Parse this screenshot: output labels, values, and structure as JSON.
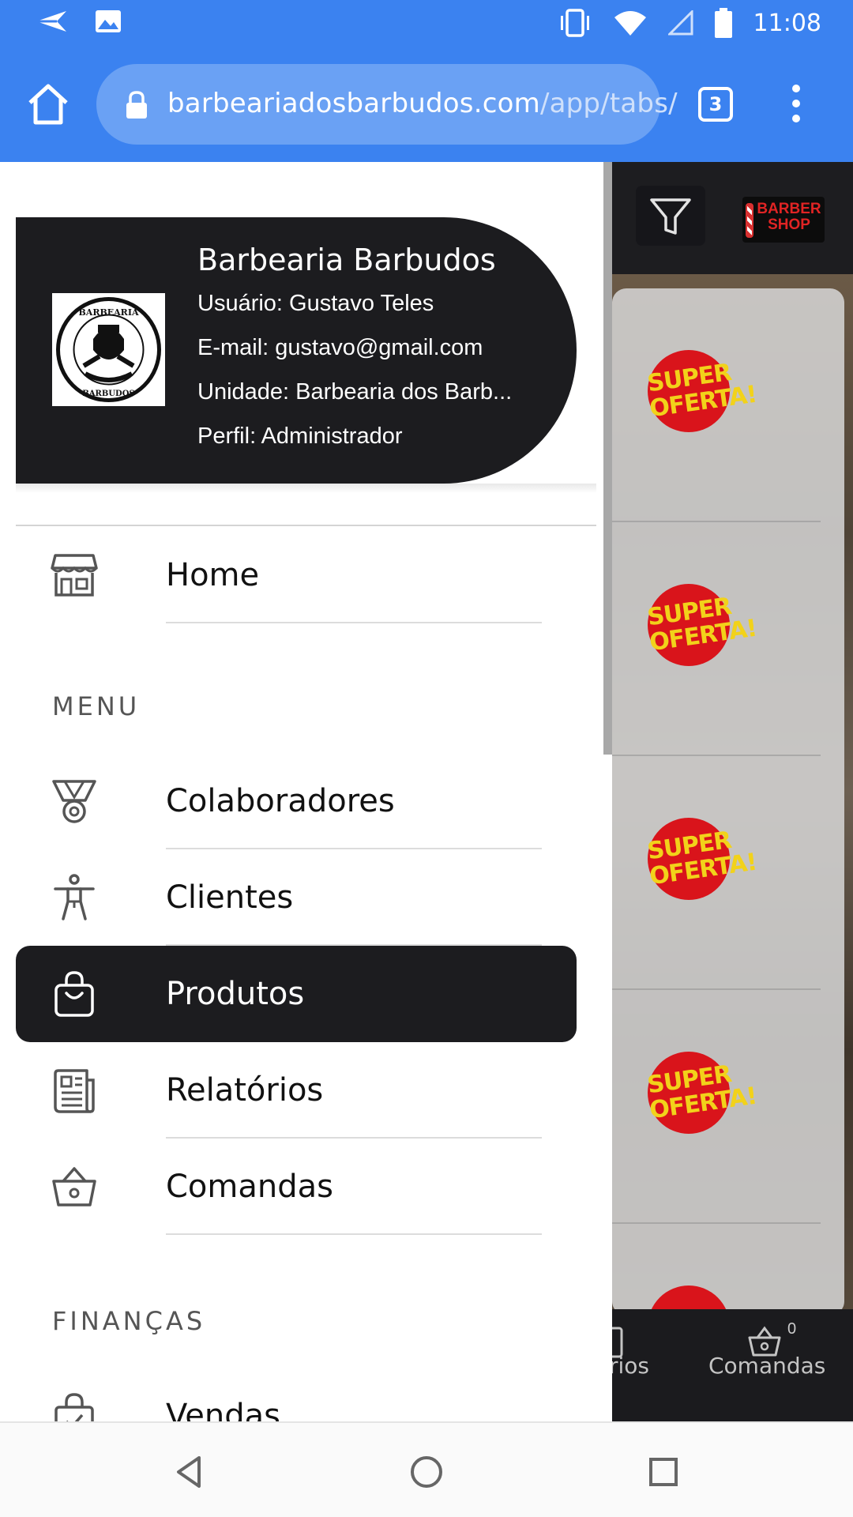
{
  "status_bar": {
    "time": "11:08",
    "icons": [
      "send-icon",
      "image-icon",
      "vibrate-icon",
      "wifi-icon",
      "signal-icon",
      "battery-icon"
    ]
  },
  "browser": {
    "url_domain": "barbeariadosbarbudos.com",
    "url_path": "/app/tabs/",
    "tab_count": "3"
  },
  "profile": {
    "name": "Barbearia Barbudos",
    "user": "Usuário: Gustavo Teles",
    "email": "E-mail: gustavo@gmail.com",
    "unit": "Unidade: Barbearia dos Barb...",
    "role": "Perfil: Administrador",
    "logo_text": "BARBEARIA DOS BARBUDOS"
  },
  "drawer": {
    "home_label": "Home",
    "menu_title": "MENU",
    "items": [
      {
        "label": "Colaboradores",
        "icon": "medal-icon"
      },
      {
        "label": "Clientes",
        "icon": "person-icon"
      },
      {
        "label": "Produtos",
        "icon": "shopping-bag-icon",
        "active": true
      },
      {
        "label": "Relatórios",
        "icon": "newspaper-icon"
      },
      {
        "label": "Comandas",
        "icon": "basket-icon"
      }
    ],
    "finance_title": "FINANÇAS",
    "finance_items": [
      {
        "label": "Vendas",
        "icon": "bag-check-icon"
      }
    ]
  },
  "background_app": {
    "logo_text": "BARBER SHOP",
    "badge_text": "SUPER OFERTA!",
    "tabs": [
      {
        "label": "rios"
      },
      {
        "label": "Comandas",
        "count": "0"
      }
    ]
  },
  "colors": {
    "brand_bar": "#3b82f0",
    "drawer_dark": "#1c1c1f",
    "badge_red": "#d9141b",
    "badge_yellow": "#f2d21a"
  }
}
